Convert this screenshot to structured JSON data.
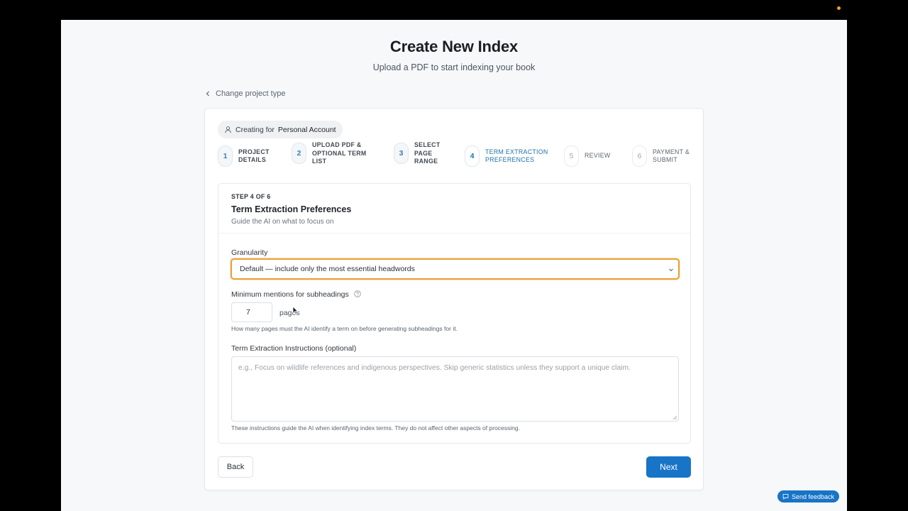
{
  "header": {
    "title": "Create New Index",
    "subtitle": "Upload a PDF to start indexing your book"
  },
  "back_link": {
    "label": "Change project type",
    "icon": "chevron-left-icon"
  },
  "account": {
    "prefix": "Creating for",
    "name": "Personal Account",
    "icon": "user-icon"
  },
  "steps": [
    {
      "number": "1",
      "line1": "PROJECT",
      "line2": "DETAILS",
      "line3": "",
      "state": "done"
    },
    {
      "number": "2",
      "line1": "UPLOAD PDF &",
      "line2": "OPTIONAL TERM",
      "line3": "LIST",
      "state": "done"
    },
    {
      "number": "3",
      "line1": "SELECT",
      "line2": "PAGE",
      "line3": "RANGE",
      "state": "done"
    },
    {
      "number": "4",
      "line1": "TERM EXTRACTION",
      "line2": "PREFERENCES",
      "line3": "",
      "state": "active"
    },
    {
      "number": "5",
      "line1": "REVIEW",
      "line2": "",
      "line3": "",
      "state": "pending"
    },
    {
      "number": "6",
      "line1": "PAYMENT &",
      "line2": "SUBMIT",
      "line3": "",
      "state": "pending"
    }
  ],
  "section": {
    "step_count": "STEP 4 OF 6",
    "title": "Term Extraction Preferences",
    "subtitle": "Guide the AI on what to focus on"
  },
  "granularity": {
    "label": "Granularity",
    "selected": "Default — include only the most essential headwords"
  },
  "min_mentions": {
    "label": "Minimum mentions for subheadings",
    "value": "7",
    "suffix": "pages",
    "hint": "How many pages must the AI identify a term on before generating subheadings for it."
  },
  "instructions": {
    "label": "Term Extraction Instructions (optional)",
    "placeholder": "e.g., Focus on wildlife references and indigenous perspectives. Skip generic statistics unless they support a unique claim.",
    "hint": "These instructions guide the AI when identifying index terms. They do not affect other aspects of processing."
  },
  "buttons": {
    "back": "Back",
    "next": "Next"
  },
  "feedback": {
    "label": "Send feedback",
    "icon": "chat-icon"
  },
  "colors": {
    "accent": "#1874c6",
    "focus": "#e9a23b"
  }
}
